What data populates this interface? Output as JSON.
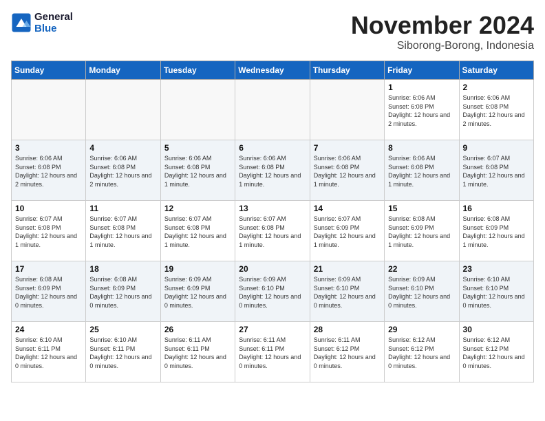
{
  "header": {
    "logo_line1": "General",
    "logo_line2": "Blue",
    "month_title": "November 2024",
    "subtitle": "Siborong-Borong, Indonesia"
  },
  "weekdays": [
    "Sunday",
    "Monday",
    "Tuesday",
    "Wednesday",
    "Thursday",
    "Friday",
    "Saturday"
  ],
  "weeks": [
    [
      {
        "day": "",
        "info": ""
      },
      {
        "day": "",
        "info": ""
      },
      {
        "day": "",
        "info": ""
      },
      {
        "day": "",
        "info": ""
      },
      {
        "day": "",
        "info": ""
      },
      {
        "day": "1",
        "info": "Sunrise: 6:06 AM\nSunset: 6:08 PM\nDaylight: 12 hours and 2 minutes."
      },
      {
        "day": "2",
        "info": "Sunrise: 6:06 AM\nSunset: 6:08 PM\nDaylight: 12 hours and 2 minutes."
      }
    ],
    [
      {
        "day": "3",
        "info": "Sunrise: 6:06 AM\nSunset: 6:08 PM\nDaylight: 12 hours and 2 minutes."
      },
      {
        "day": "4",
        "info": "Sunrise: 6:06 AM\nSunset: 6:08 PM\nDaylight: 12 hours and 2 minutes."
      },
      {
        "day": "5",
        "info": "Sunrise: 6:06 AM\nSunset: 6:08 PM\nDaylight: 12 hours and 1 minute."
      },
      {
        "day": "6",
        "info": "Sunrise: 6:06 AM\nSunset: 6:08 PM\nDaylight: 12 hours and 1 minute."
      },
      {
        "day": "7",
        "info": "Sunrise: 6:06 AM\nSunset: 6:08 PM\nDaylight: 12 hours and 1 minute."
      },
      {
        "day": "8",
        "info": "Sunrise: 6:06 AM\nSunset: 6:08 PM\nDaylight: 12 hours and 1 minute."
      },
      {
        "day": "9",
        "info": "Sunrise: 6:07 AM\nSunset: 6:08 PM\nDaylight: 12 hours and 1 minute."
      }
    ],
    [
      {
        "day": "10",
        "info": "Sunrise: 6:07 AM\nSunset: 6:08 PM\nDaylight: 12 hours and 1 minute."
      },
      {
        "day": "11",
        "info": "Sunrise: 6:07 AM\nSunset: 6:08 PM\nDaylight: 12 hours and 1 minute."
      },
      {
        "day": "12",
        "info": "Sunrise: 6:07 AM\nSunset: 6:08 PM\nDaylight: 12 hours and 1 minute."
      },
      {
        "day": "13",
        "info": "Sunrise: 6:07 AM\nSunset: 6:08 PM\nDaylight: 12 hours and 1 minute."
      },
      {
        "day": "14",
        "info": "Sunrise: 6:07 AM\nSunset: 6:09 PM\nDaylight: 12 hours and 1 minute."
      },
      {
        "day": "15",
        "info": "Sunrise: 6:08 AM\nSunset: 6:09 PM\nDaylight: 12 hours and 1 minute."
      },
      {
        "day": "16",
        "info": "Sunrise: 6:08 AM\nSunset: 6:09 PM\nDaylight: 12 hours and 1 minute."
      }
    ],
    [
      {
        "day": "17",
        "info": "Sunrise: 6:08 AM\nSunset: 6:09 PM\nDaylight: 12 hours and 0 minutes."
      },
      {
        "day": "18",
        "info": "Sunrise: 6:08 AM\nSunset: 6:09 PM\nDaylight: 12 hours and 0 minutes."
      },
      {
        "day": "19",
        "info": "Sunrise: 6:09 AM\nSunset: 6:09 PM\nDaylight: 12 hours and 0 minutes."
      },
      {
        "day": "20",
        "info": "Sunrise: 6:09 AM\nSunset: 6:10 PM\nDaylight: 12 hours and 0 minutes."
      },
      {
        "day": "21",
        "info": "Sunrise: 6:09 AM\nSunset: 6:10 PM\nDaylight: 12 hours and 0 minutes."
      },
      {
        "day": "22",
        "info": "Sunrise: 6:09 AM\nSunset: 6:10 PM\nDaylight: 12 hours and 0 minutes."
      },
      {
        "day": "23",
        "info": "Sunrise: 6:10 AM\nSunset: 6:10 PM\nDaylight: 12 hours and 0 minutes."
      }
    ],
    [
      {
        "day": "24",
        "info": "Sunrise: 6:10 AM\nSunset: 6:11 PM\nDaylight: 12 hours and 0 minutes."
      },
      {
        "day": "25",
        "info": "Sunrise: 6:10 AM\nSunset: 6:11 PM\nDaylight: 12 hours and 0 minutes."
      },
      {
        "day": "26",
        "info": "Sunrise: 6:11 AM\nSunset: 6:11 PM\nDaylight: 12 hours and 0 minutes."
      },
      {
        "day": "27",
        "info": "Sunrise: 6:11 AM\nSunset: 6:11 PM\nDaylight: 12 hours and 0 minutes."
      },
      {
        "day": "28",
        "info": "Sunrise: 6:11 AM\nSunset: 6:12 PM\nDaylight: 12 hours and 0 minutes."
      },
      {
        "day": "29",
        "info": "Sunrise: 6:12 AM\nSunset: 6:12 PM\nDaylight: 12 hours and 0 minutes."
      },
      {
        "day": "30",
        "info": "Sunrise: 6:12 AM\nSunset: 6:12 PM\nDaylight: 12 hours and 0 minutes."
      }
    ]
  ]
}
